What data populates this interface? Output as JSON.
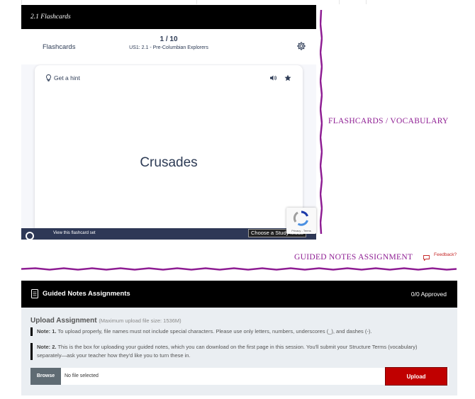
{
  "flashcards": {
    "window_title": "2.1 Flashcards",
    "label": "Flashcards",
    "counter": "1 / 10",
    "set_name": "US1: 2.1 - Pre-Columbian Explorers",
    "hint": "Get a hint",
    "term": "Crusades",
    "footer_link": "View this flashcard set",
    "study_mode": "Choose a Study Mode",
    "recaptcha_text": "Privacy - Terms"
  },
  "annotations": {
    "flashcards_label": "FLASHCARDS / VOCABULARY",
    "guided_label": "GUIDED NOTES ASSIGNMENT",
    "feedback": "Feedback?",
    "accent_color": "#8e1d93"
  },
  "guided_notes": {
    "title": "Guided Notes Assignments",
    "approved": "0/0 Approved",
    "upload_title": "Upload Assignment",
    "upload_limit": "(Maximum upload file size: 1536M)",
    "note1_label": "Note: 1.",
    "note1_text": "To upload properly, file names must not include special characters. Please use only letters, numbers, underscores (_), and dashes (-).",
    "note2_label": "Note: 2.",
    "note2_text": "This is the box for uploading your guided notes, which you can download on the first page in this session. You'll submit your Structure Terms (vocabulary) separately—ask your teacher how they'd like you to turn these in.",
    "browse_label": "Browse",
    "file_status": "No file selected",
    "upload_label": "Upload",
    "upload_color": "#c00000"
  }
}
